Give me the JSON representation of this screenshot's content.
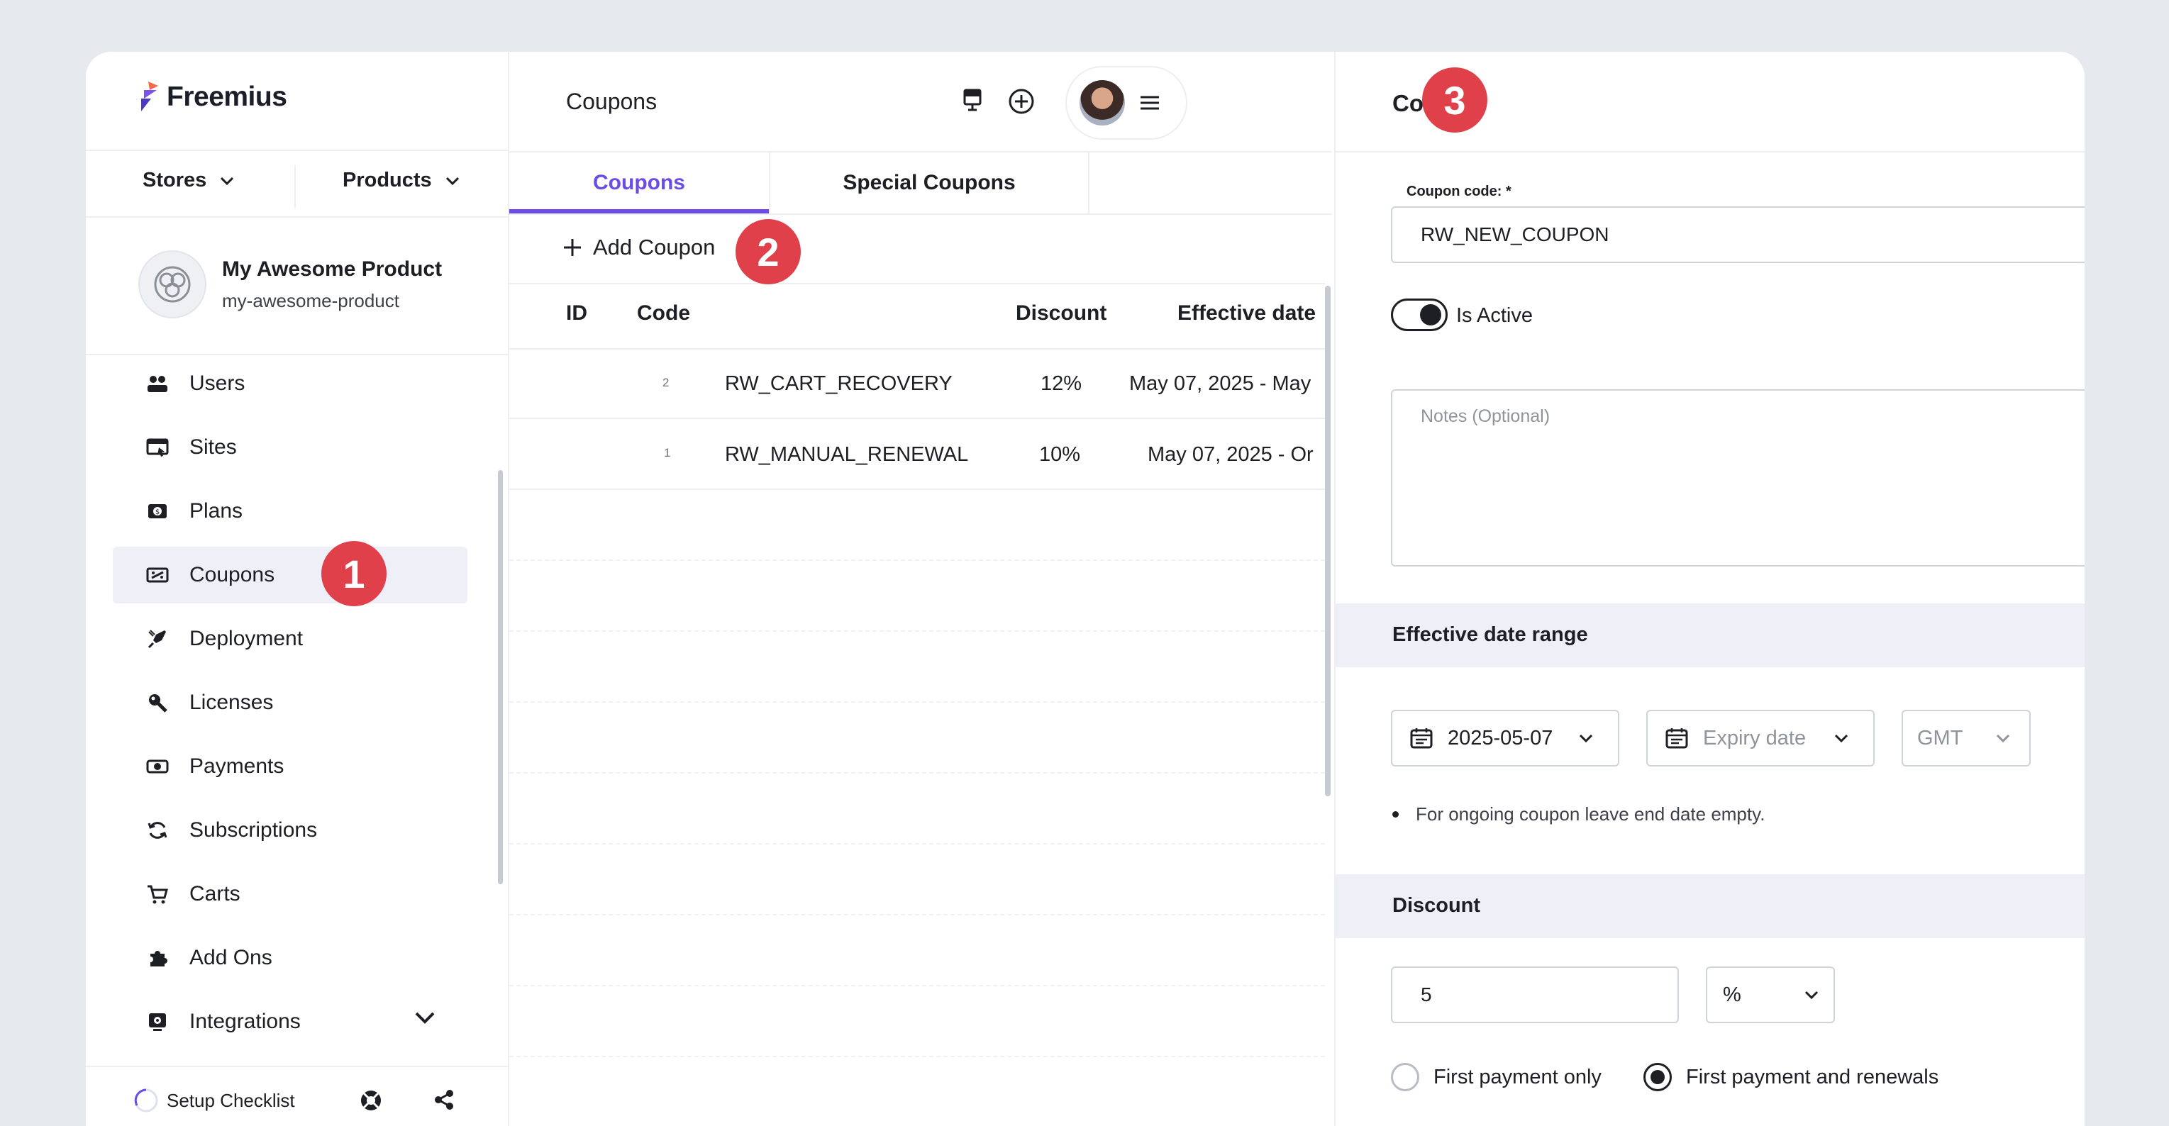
{
  "brand": {
    "name": "Freemius",
    "accent": "#6b4ce6",
    "callout_color": "#e0404a"
  },
  "sidebar": {
    "selectors": [
      {
        "label": "Stores"
      },
      {
        "label": "Products"
      }
    ],
    "product": {
      "name": "My Awesome Product",
      "slug": "my-awesome-product"
    },
    "items": [
      {
        "label": "Users",
        "icon": "users-icon"
      },
      {
        "label": "Sites",
        "icon": "sites-icon"
      },
      {
        "label": "Plans",
        "icon": "plans-icon"
      },
      {
        "label": "Coupons",
        "icon": "coupons-icon",
        "active": true
      },
      {
        "label": "Deployment",
        "icon": "deployment-icon"
      },
      {
        "label": "Licenses",
        "icon": "key-icon"
      },
      {
        "label": "Payments",
        "icon": "payments-icon"
      },
      {
        "label": "Subscriptions",
        "icon": "subscriptions-icon"
      },
      {
        "label": "Carts",
        "icon": "cart-icon"
      },
      {
        "label": "Add Ons",
        "icon": "addons-icon"
      },
      {
        "label": "Integrations",
        "icon": "integrations-icon"
      }
    ],
    "footer": {
      "setup_label": "Setup Checklist"
    }
  },
  "main": {
    "title": "Coupons",
    "tabs": [
      {
        "label": "Coupons",
        "active": true
      },
      {
        "label": "Special Coupons"
      }
    ],
    "add_label": "Add Coupon",
    "columns": [
      "ID",
      "Code",
      "Discount",
      "Effective date"
    ],
    "rows": [
      {
        "id": "2",
        "code": "RW_CART_RECOVERY",
        "discount": "12%",
        "date": "May 07, 2025 - May"
      },
      {
        "id": "1",
        "code": "RW_MANUAL_RENEWAL",
        "discount": "10%",
        "date": "May 07, 2025 - Or"
      }
    ]
  },
  "panel": {
    "title": "Coupon",
    "coupon_code_label": "Coupon code: *",
    "coupon_code_value": "RW_NEW_COUPON",
    "active_label": "Is Active",
    "notes_placeholder": "Notes (Optional)",
    "date_section": "Effective date range",
    "start_date": "2025-05-07",
    "expiry_placeholder": "Expiry date",
    "timezone": "GMT",
    "hint": "For ongoing coupon leave end date empty.",
    "discount_section": "Discount",
    "discount_value": "5",
    "discount_unit": "%",
    "radio_options": [
      {
        "label": "First payment only"
      },
      {
        "label": "First payment and renewals",
        "selected": true
      }
    ]
  },
  "callouts": [
    "1",
    "2",
    "3"
  ]
}
